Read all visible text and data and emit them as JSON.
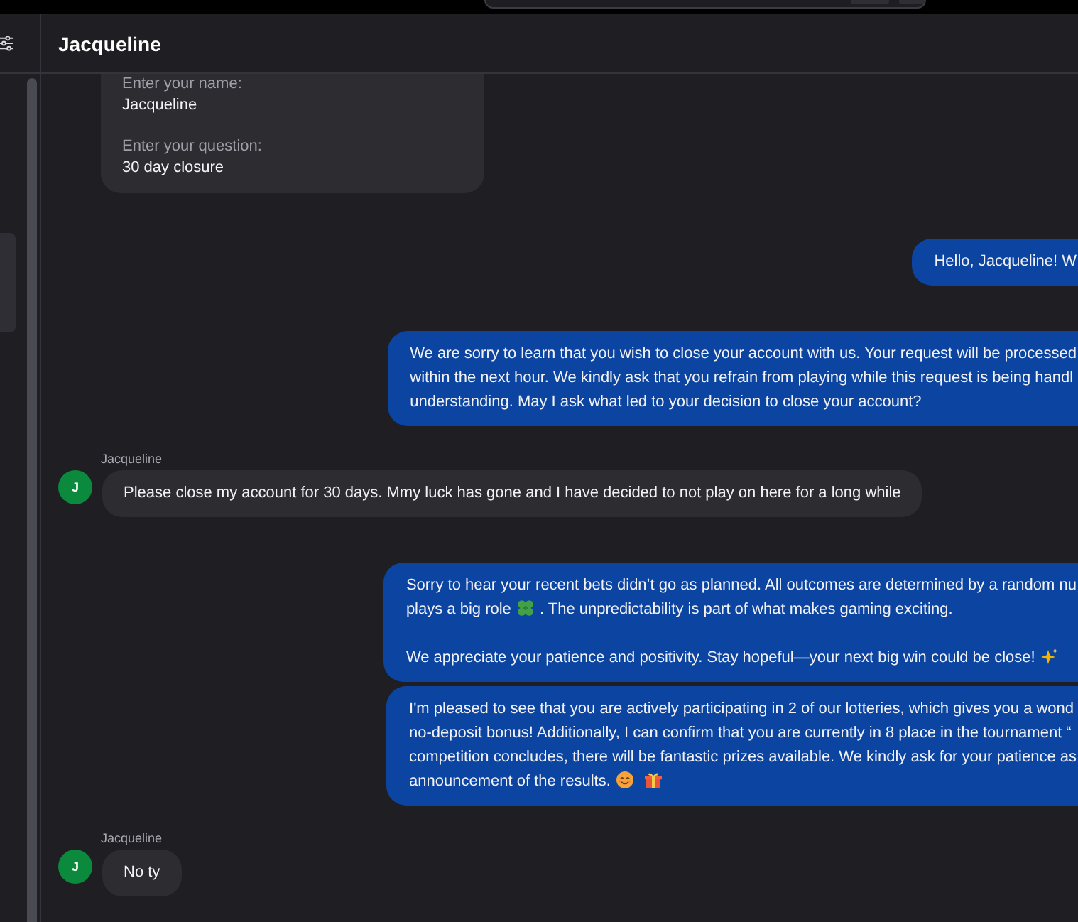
{
  "chat": {
    "title": "Jacqueline"
  },
  "messages": [
    {
      "kind": "form",
      "fields": [
        {
          "label": "Enter your name:",
          "value": "Jacqueline"
        },
        {
          "label": "Enter your question:",
          "value": "30 day closure"
        }
      ]
    },
    {
      "kind": "outgoing",
      "bubbles": [
        {
          "paragraphs": [
            {
              "lines": [
                [
                  {
                    "kind": "text",
                    "text": "Hello, Jacqueline! W"
                  }
                ]
              ]
            }
          ]
        }
      ]
    },
    {
      "kind": "outgoing",
      "bubbles": [
        {
          "paragraphs": [
            {
              "lines": [
                [
                  {
                    "kind": "text",
                    "text": "We are sorry to learn that you wish to close your account with us. Your request will be processed"
                  }
                ],
                [
                  {
                    "kind": "text",
                    "text": "within the next hour. We kindly ask that you refrain from playing while this request is being handl"
                  }
                ],
                [
                  {
                    "kind": "text",
                    "text": "understanding. May I ask what led to your decision to close your account?"
                  }
                ]
              ]
            }
          ]
        }
      ]
    },
    {
      "kind": "incoming",
      "sender": "Jacqueline",
      "avatar": "J",
      "bubbles": [
        {
          "paragraphs": [
            {
              "lines": [
                [
                  {
                    "kind": "text",
                    "text": "Please close my account for 30 days. Mmy luck has gone and I have decided to not play on here for a long while"
                  }
                ]
              ]
            }
          ]
        }
      ]
    },
    {
      "kind": "outgoing",
      "bubbles": [
        {
          "paragraphs": [
            {
              "lines": [
                [
                  {
                    "kind": "text",
                    "text": "Sorry to hear your recent bets didn’t go as planned. All outcomes are determined by a random nu"
                  }
                ],
                [
                  {
                    "kind": "text",
                    "text": "plays a big role"
                  },
                  {
                    "kind": "clover"
                  },
                  {
                    "kind": "text",
                    "text": ". The unpredictability is part of what makes gaming exciting."
                  }
                ]
              ]
            },
            {
              "lines": [
                [
                  {
                    "kind": "text",
                    "text": "We appreciate your patience and positivity. Stay hopeful—your next big win could be close!"
                  },
                  {
                    "kind": "sparkles"
                  }
                ]
              ]
            }
          ]
        },
        {
          "paragraphs": [
            {
              "lines": [
                [
                  {
                    "kind": "text",
                    "text": "I'm pleased to see that you are actively participating in 2 of our lotteries, which gives you a wond"
                  }
                ],
                [
                  {
                    "kind": "text",
                    "text": "no-deposit bonus! Additionally, I can confirm that you are currently in 8 place in the tournament “"
                  }
                ],
                [
                  {
                    "kind": "text",
                    "text": "competition concludes, there will be fantastic prizes available. We kindly ask for your patience as"
                  }
                ],
                [
                  {
                    "kind": "text",
                    "text": "announcement of the results."
                  },
                  {
                    "kind": "smile"
                  },
                  {
                    "kind": "gift"
                  }
                ]
              ]
            }
          ]
        }
      ]
    },
    {
      "kind": "incoming",
      "sender": "Jacqueline",
      "avatar": "J",
      "bubbles": [
        {
          "paragraphs": [
            {
              "lines": [
                [
                  {
                    "kind": "text",
                    "text": "No ty"
                  }
                ]
              ]
            }
          ]
        }
      ]
    }
  ]
}
